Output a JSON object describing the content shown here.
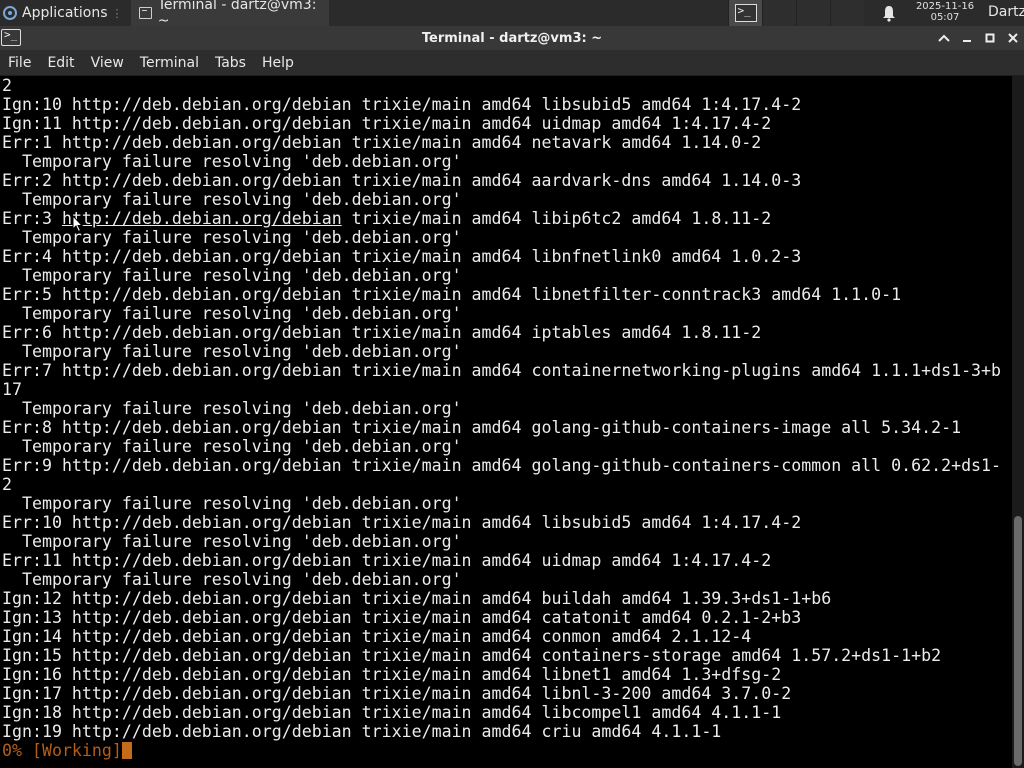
{
  "panel": {
    "applications_label": "Applications",
    "task_label": "Terminal - dartz@vm3: ~",
    "clock_date": "2025-11-16",
    "clock_time": "05:07",
    "user": "Dartz"
  },
  "window": {
    "title": "Terminal - dartz@vm3: ~",
    "controls": [
      "^",
      "–",
      "□",
      "✕"
    ]
  },
  "menubar": {
    "items": [
      "File",
      "Edit",
      "View",
      "Terminal",
      "Tabs",
      "Help"
    ]
  },
  "terminal": {
    "lines": [
      "2",
      "Ign:10 http://deb.debian.org/debian trixie/main amd64 libsubid5 amd64 1:4.17.4-2",
      "Ign:11 http://deb.debian.org/debian trixie/main amd64 uidmap amd64 1:4.17.4-2",
      "Err:1 http://deb.debian.org/debian trixie/main amd64 netavark amd64 1.14.0-2",
      "  Temporary failure resolving 'deb.debian.org'",
      "Err:2 http://deb.debian.org/debian trixie/main amd64 aardvark-dns amd64 1.14.0-3",
      "  Temporary failure resolving 'deb.debian.org'",
      "Err:3 http://deb.debian.org/debian trixie/main amd64 libip6tc2 amd64 1.8.11-2",
      "  Temporary failure resolving 'deb.debian.org'",
      "Err:4 http://deb.debian.org/debian trixie/main amd64 libnfnetlink0 amd64 1.0.2-3",
      "  Temporary failure resolving 'deb.debian.org'",
      "Err:5 http://deb.debian.org/debian trixie/main amd64 libnetfilter-conntrack3 amd64 1.1.0-1",
      "  Temporary failure resolving 'deb.debian.org'",
      "Err:6 http://deb.debian.org/debian trixie/main amd64 iptables amd64 1.8.11-2",
      "  Temporary failure resolving 'deb.debian.org'",
      "Err:7 http://deb.debian.org/debian trixie/main amd64 containernetworking-plugins amd64 1.1.1+ds1-3+b",
      "17",
      "  Temporary failure resolving 'deb.debian.org'",
      "Err:8 http://deb.debian.org/debian trixie/main amd64 golang-github-containers-image all 5.34.2-1",
      "  Temporary failure resolving 'deb.debian.org'",
      "Err:9 http://deb.debian.org/debian trixie/main amd64 golang-github-containers-common all 0.62.2+ds1-",
      "2",
      "  Temporary failure resolving 'deb.debian.org'",
      "Err:10 http://deb.debian.org/debian trixie/main amd64 libsubid5 amd64 1:4.17.4-2",
      "  Temporary failure resolving 'deb.debian.org'",
      "Err:11 http://deb.debian.org/debian trixie/main amd64 uidmap amd64 1:4.17.4-2",
      "  Temporary failure resolving 'deb.debian.org'",
      "Ign:12 http://deb.debian.org/debian trixie/main amd64 buildah amd64 1.39.3+ds1-1+b6",
      "Ign:13 http://deb.debian.org/debian trixie/main amd64 catatonit amd64 0.2.1-2+b3",
      "Ign:14 http://deb.debian.org/debian trixie/main amd64 conmon amd64 2.1.12-4",
      "Ign:15 http://deb.debian.org/debian trixie/main amd64 containers-storage amd64 1.57.2+ds1-1+b2",
      "Ign:16 http://deb.debian.org/debian trixie/main amd64 libnet1 amd64 1.3+dfsg-2",
      "Ign:17 http://deb.debian.org/debian trixie/main amd64 libnl-3-200 amd64 3.7.0-2",
      "Ign:18 http://deb.debian.org/debian trixie/main amd64 libcompel1 amd64 4.1.1-1",
      "Ign:19 http://deb.debian.org/debian trixie/main amd64 criu amd64 4.1.1-1"
    ],
    "prompt": "0% [Working]",
    "hovered_link": "http://deb.debian.org/debian",
    "colors": {
      "background": "#000000",
      "foreground": "#ececec",
      "progress": "#b35d18",
      "cursor": "#c56b1a"
    }
  }
}
